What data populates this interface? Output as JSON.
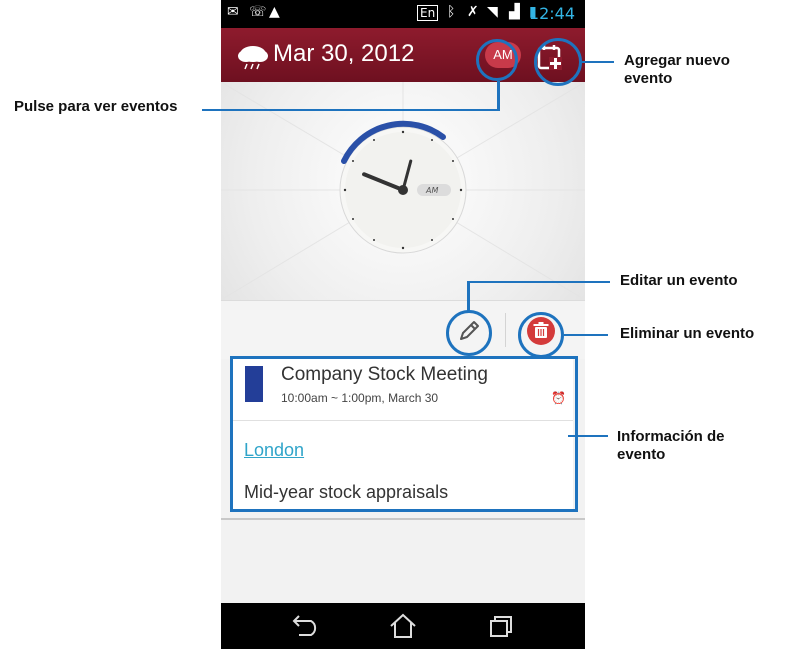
{
  "status_bar": {
    "time": "12:44",
    "keyboard_lang": "En",
    "left_icons": [
      "gmail-icon",
      "missed-call-icon",
      "warning-icon"
    ],
    "right_icons": [
      "bluetooth-icon",
      "mute-icon",
      "wifi-icon",
      "signal-icon",
      "battery-icon"
    ]
  },
  "app_bar": {
    "date": "Mar 30, 2012",
    "ampm": "AM",
    "weather_icon": "cloud-rain-icon",
    "add_icon": "calendar-add-icon"
  },
  "clock": {
    "ampm_label": "AM",
    "hour": 9,
    "minute": 44
  },
  "event": {
    "color": "#233e98",
    "title": "Company Stock Meeting",
    "time": "10:00am ~ 1:00pm, March 30",
    "location": "London",
    "description": "Mid-year stock appraisals"
  },
  "callouts": {
    "add_event": [
      "Agregar nuevo",
      "evento"
    ],
    "view_events": "Pulse para ver eventos",
    "edit_event": "Editar un evento",
    "delete_event": "Eliminar un evento",
    "event_info": [
      "Información de",
      "evento"
    ]
  },
  "colors": {
    "accent": "#1e73be",
    "appbar": "#8e1b2d",
    "status_time": "#33b5e5",
    "location_link": "#2fa4c9"
  }
}
